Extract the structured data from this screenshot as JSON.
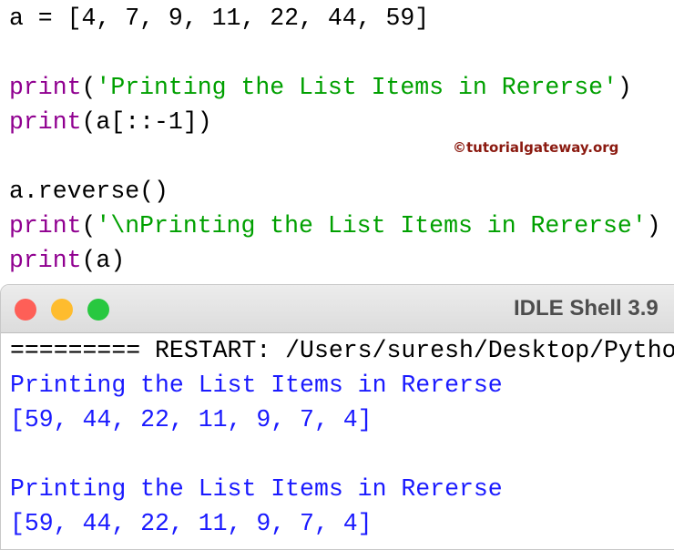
{
  "editor": {
    "lines": [
      {
        "parts": [
          {
            "t": "a = [4, 7, 9, 11, 22, 44, 59]",
            "c": ""
          }
        ]
      },
      {
        "parts": []
      },
      {
        "parts": [
          {
            "t": "print",
            "c": "kw"
          },
          {
            "t": "(",
            "c": ""
          },
          {
            "t": "'Printing the List Items in Rererse'",
            "c": "str"
          },
          {
            "t": ")",
            "c": ""
          }
        ]
      },
      {
        "parts": [
          {
            "t": "print",
            "c": "kw"
          },
          {
            "t": "(a[::-1])",
            "c": ""
          }
        ]
      },
      {
        "parts": []
      },
      {
        "parts": [
          {
            "t": "a.reverse()",
            "c": ""
          }
        ]
      },
      {
        "parts": [
          {
            "t": "print",
            "c": "kw"
          },
          {
            "t": "(",
            "c": ""
          },
          {
            "t": "'\\nPrinting the List Items in Rererse'",
            "c": "str"
          },
          {
            "t": ")",
            "c": ""
          }
        ]
      },
      {
        "parts": [
          {
            "t": "print",
            "c": "kw"
          },
          {
            "t": "(a)",
            "c": ""
          }
        ]
      }
    ]
  },
  "watermark": "©tutorialgateway.org",
  "shell_window": {
    "title": "IDLE Shell 3.9",
    "lines": [
      {
        "text": "========= RESTART: /Users/suresh/Desktop/Python",
        "c": ""
      },
      {
        "text": "Printing the List Items in Rererse",
        "c": "out"
      },
      {
        "text": "[59, 44, 22, 11, 9, 7, 4]",
        "c": "out"
      },
      {
        "text": "",
        "c": ""
      },
      {
        "text": "Printing the List Items in Rererse",
        "c": "out"
      },
      {
        "text": "[59, 44, 22, 11, 9, 7, 4]",
        "c": "out"
      }
    ]
  }
}
